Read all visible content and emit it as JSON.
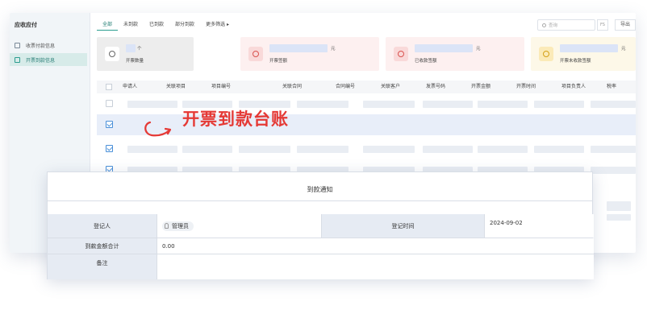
{
  "sidebar": {
    "title": "应收应付",
    "items": [
      {
        "label": "收票付款信息",
        "active": false
      },
      {
        "label": "开票到款信息",
        "active": true
      }
    ]
  },
  "tabs": [
    "全部",
    "未到款",
    "已到款",
    "部分到款",
    "更多筛选 ▸"
  ],
  "search": {
    "placeholder": "查询"
  },
  "toolbar": {
    "filter_label": "FS",
    "export_label": "导出"
  },
  "cards": [
    {
      "label": "开票数量",
      "unit": "个",
      "icon": "invoice-count-icon"
    },
    {
      "label": "开票签额",
      "unit": "元",
      "icon": "invoice-amount-icon"
    },
    {
      "label": "已收款签额",
      "unit": "元",
      "icon": "received-amount-icon"
    },
    {
      "label": "开票未收款签额",
      "unit": "元",
      "icon": "unreceived-amount-icon"
    }
  ],
  "table": {
    "columns": [
      "申请人",
      "关联项目",
      "项目编号",
      "关联合同",
      "合同编号",
      "关联客户",
      "发票号码",
      "开票金额",
      "开票时间",
      "项目负责人",
      "税率"
    ]
  },
  "overlay": {
    "title": "开票到款台账"
  },
  "form": {
    "title": "到款通知",
    "registrant_label": "登记人",
    "registrant_value": "管理员",
    "register_time_label": "登记时间",
    "register_time_value": "2024-09-02",
    "total_label": "到款金额合计",
    "total_value": "0.00",
    "remark_label": "备注",
    "remark_value": ""
  }
}
